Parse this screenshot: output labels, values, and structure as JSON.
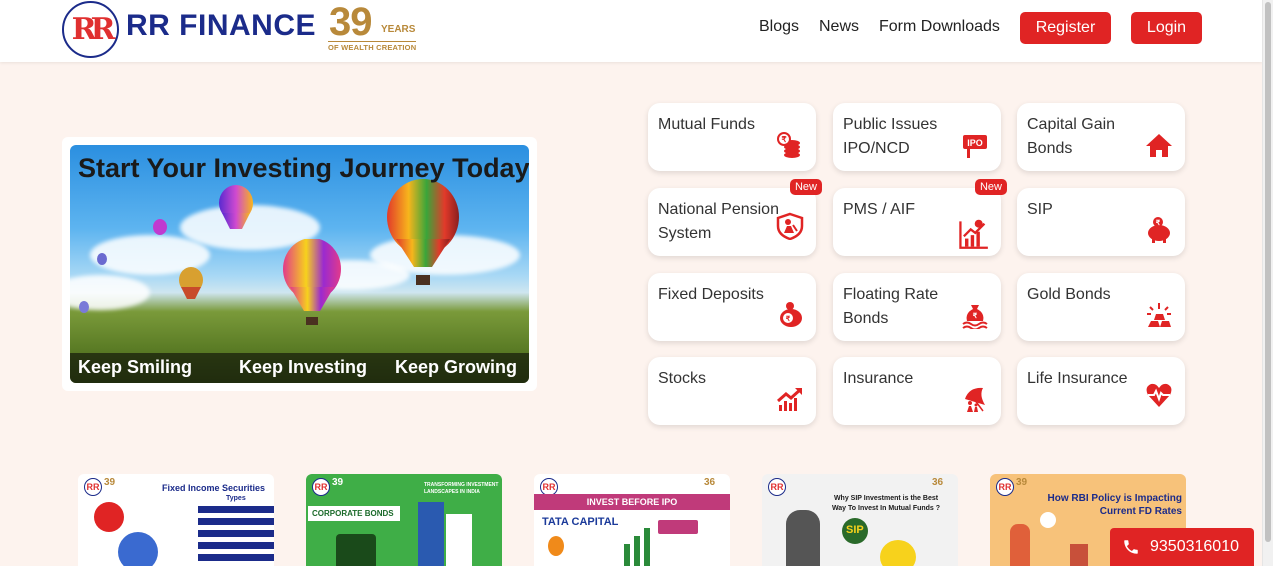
{
  "brand": {
    "logo_letters": "RR",
    "name": "RR FINANCE",
    "years_number": "39",
    "years_word": "YEARS",
    "years_sub": "OF WEALTH CREATION"
  },
  "nav": {
    "blogs": "Blogs",
    "news": "News",
    "form_downloads": "Form Downloads",
    "register": "Register",
    "login": "Login"
  },
  "hero": {
    "title": "Start Your Investing Journey Today",
    "tag1": "Keep Smiling",
    "tag2": "Keep Investing",
    "tag3": "Keep Growing"
  },
  "products": [
    {
      "label": "Mutual Funds",
      "icon": "coins-stack-icon",
      "badge": ""
    },
    {
      "label": "Public Issues IPO/NCD",
      "icon": "ipo-sign-icon",
      "badge": ""
    },
    {
      "label": "Capital Gain Bonds",
      "icon": "house-icon",
      "badge": ""
    },
    {
      "label": "National Pension System",
      "icon": "shield-person-icon",
      "badge": "New"
    },
    {
      "label": "PMS / AIF",
      "icon": "growth-chart-icon",
      "badge": "New"
    },
    {
      "label": "SIP",
      "icon": "piggy-bank-icon",
      "badge": ""
    },
    {
      "label": "Fixed Deposits",
      "icon": "deposit-piggy-icon",
      "badge": ""
    },
    {
      "label": "Floating Rate Bonds",
      "icon": "money-bag-water-icon",
      "badge": ""
    },
    {
      "label": "Gold Bonds",
      "icon": "gold-bars-icon",
      "badge": ""
    },
    {
      "label": "Stocks",
      "icon": "stock-up-arrow-icon",
      "badge": ""
    },
    {
      "label": "Insurance",
      "icon": "umbrella-family-icon",
      "badge": ""
    },
    {
      "label": "Life Insurance",
      "icon": "heart-pulse-icon",
      "badge": ""
    }
  ],
  "blogs": [
    {
      "title": "Fixed Income Securities",
      "sub": "Types",
      "logo_number": "39"
    },
    {
      "title": "CORPORATE BONDS",
      "sub": "TRANSFORMING INVESTMENT LANDSCAPES IN INDIA",
      "logo_number": "39"
    },
    {
      "title": "INVEST BEFORE IPO",
      "sub": "TATA CAPITAL",
      "logo_number": "36"
    },
    {
      "title": "Why SIP Investment is the Best Way To Invest In Mutual Funds ?",
      "sub": "SIP",
      "logo_number": "36"
    },
    {
      "title": "How RBI Policy is Impacting Current FD Rates",
      "sub": "",
      "logo_number": "39"
    }
  ],
  "contact": {
    "phone": "9350316010"
  },
  "colors": {
    "brand_blue": "#1b2b8a",
    "accent_red": "#e02424",
    "gold": "#b8893a",
    "page_bg": "#fdf3ee"
  }
}
